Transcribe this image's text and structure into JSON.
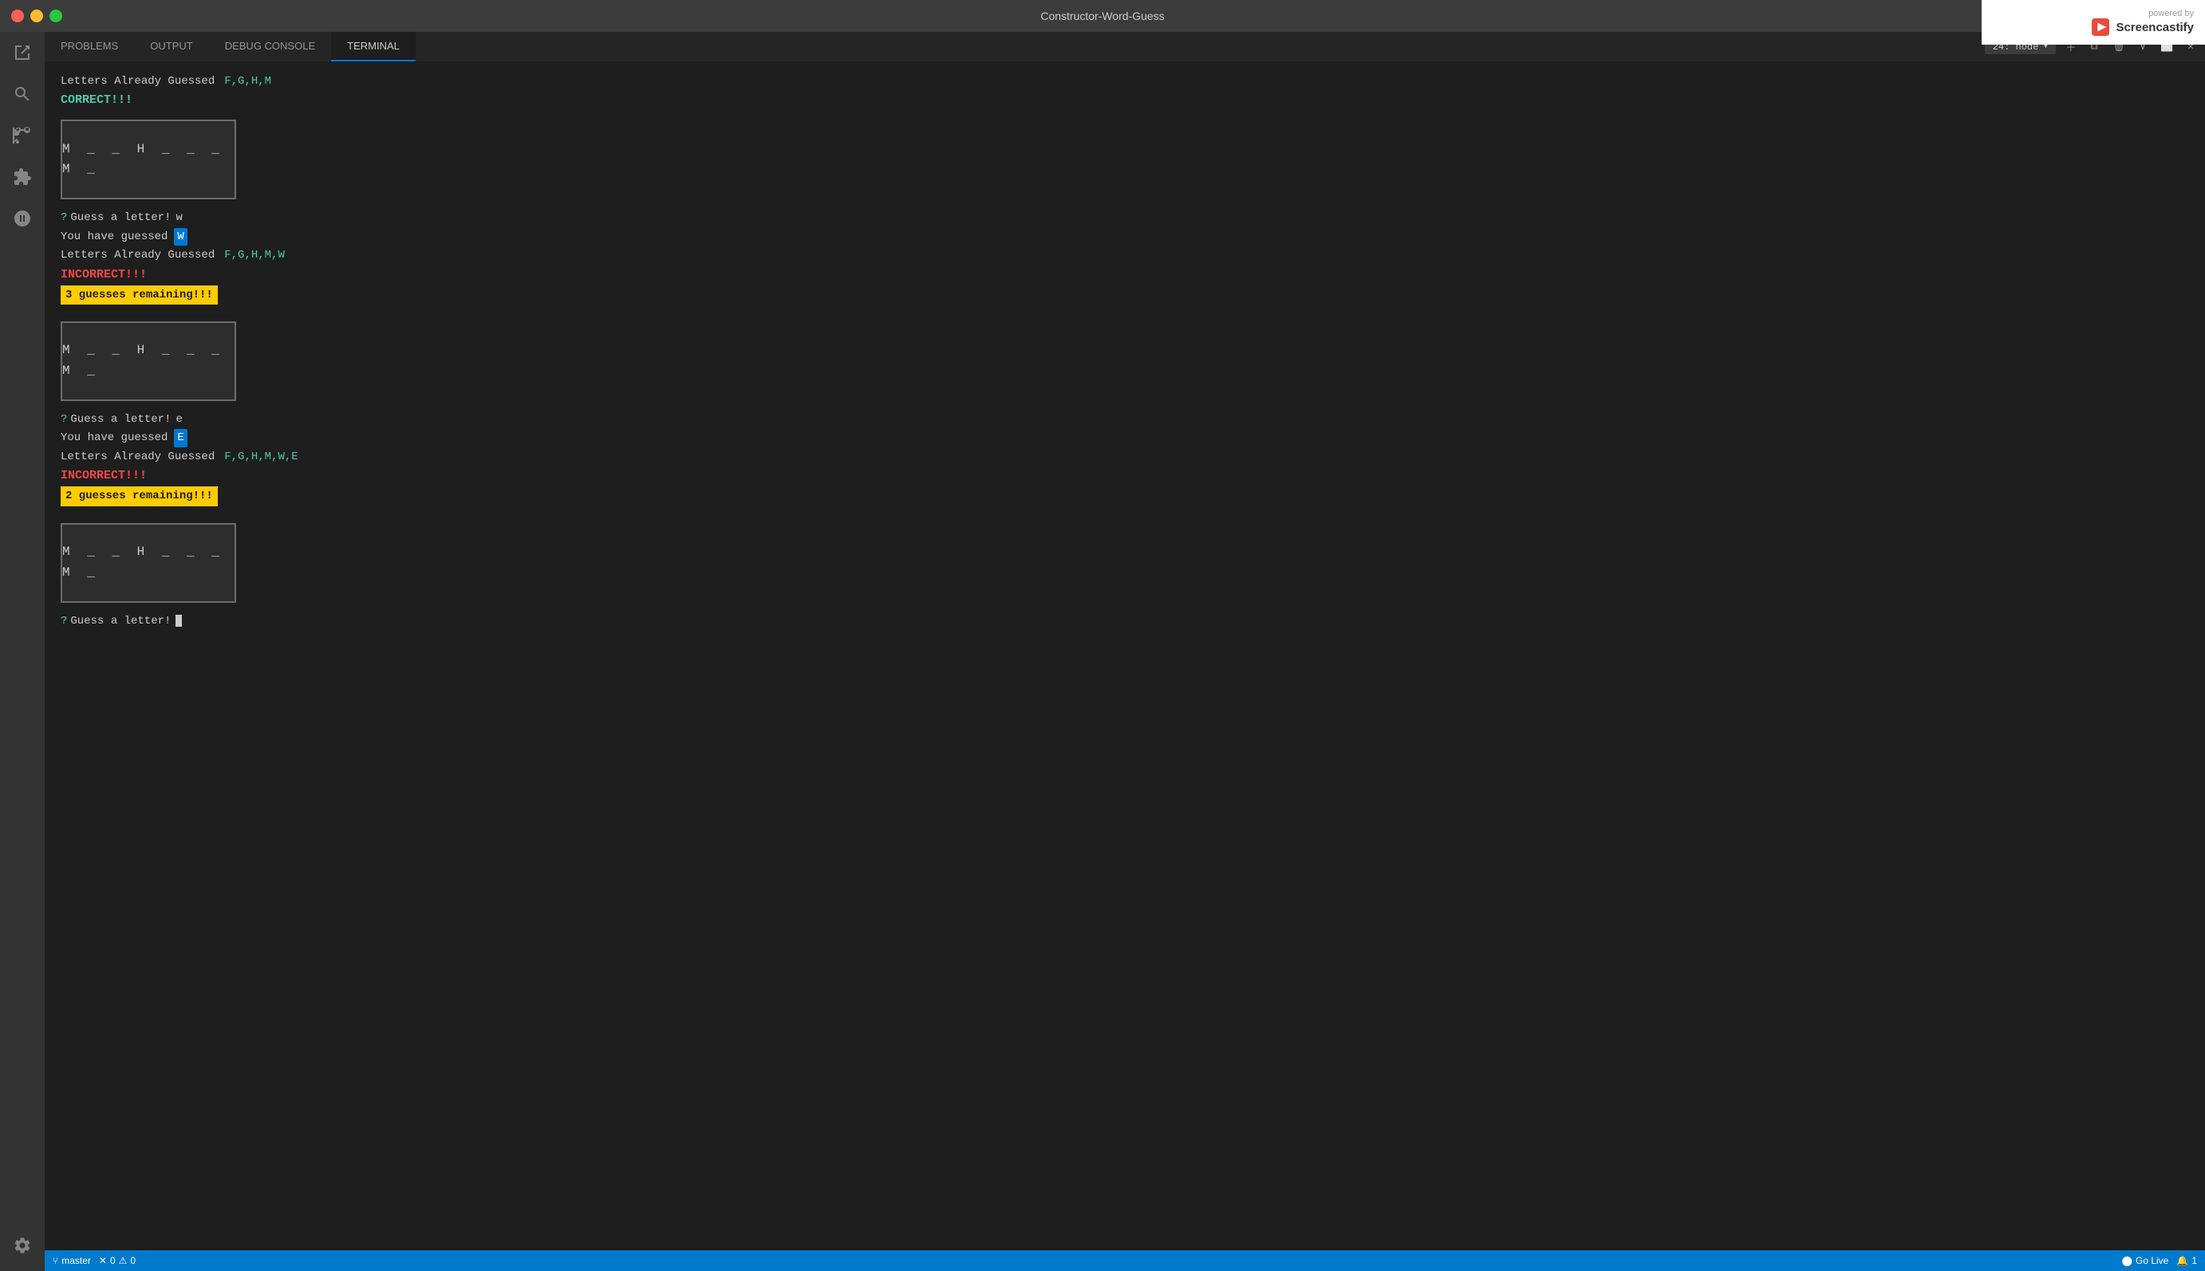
{
  "titlebar": {
    "title": "Constructor-Word-Guess"
  },
  "tabs": {
    "problems": "PROBLEMS",
    "output": "OUTPUT",
    "debug_console": "DEBUG CONSOLE",
    "terminal": "TERMINAL",
    "node_selector": "24: node"
  },
  "terminal": {
    "lines": [
      {
        "id": "line1",
        "label": "Letters Already Guessed",
        "value": "F,G,H,M"
      },
      {
        "id": "line2",
        "text": "CORRECT!!!",
        "type": "correct"
      },
      {
        "id": "box1",
        "content": "M _ _ H _ _ _ M _",
        "type": "wordbox"
      },
      {
        "id": "line3",
        "prompt": "?",
        "text": "Guess a letter!",
        "input": "w"
      },
      {
        "id": "line4",
        "label": "You have guessed",
        "value": "W",
        "highlighted": true
      },
      {
        "id": "line5",
        "label": "Letters Already Guessed",
        "value": "F,G,H,M,W"
      },
      {
        "id": "line6",
        "text": "INCORRECT!!!",
        "type": "incorrect"
      },
      {
        "id": "line7",
        "text": "3 guesses remaining!!!",
        "type": "guesses"
      },
      {
        "id": "box2",
        "content": "M _ _ H _ _ _ M _",
        "type": "wordbox"
      },
      {
        "id": "line8",
        "prompt": "?",
        "text": "Guess a letter!",
        "input": "e"
      },
      {
        "id": "line9",
        "label": "You have guessed",
        "value": "E",
        "highlighted": true
      },
      {
        "id": "line10",
        "label": "Letters Already Guessed",
        "value": "F,G,H,M,W,E"
      },
      {
        "id": "line11",
        "text": "INCORRECT!!!",
        "type": "incorrect"
      },
      {
        "id": "line12",
        "text": "2 guesses remaining!!!",
        "type": "guesses"
      },
      {
        "id": "box3",
        "content": "M _ _ H _ _ _ M _",
        "type": "wordbox"
      },
      {
        "id": "line13",
        "prompt": "?",
        "text": "Guess a letter!",
        "cursor": true
      }
    ]
  },
  "status_bar": {
    "branch": "master",
    "errors": "0",
    "warnings": "0",
    "go_live": "Go Live",
    "bell": "1"
  },
  "screencastify": {
    "powered_by": "powered by",
    "brand": "Screencastify"
  }
}
